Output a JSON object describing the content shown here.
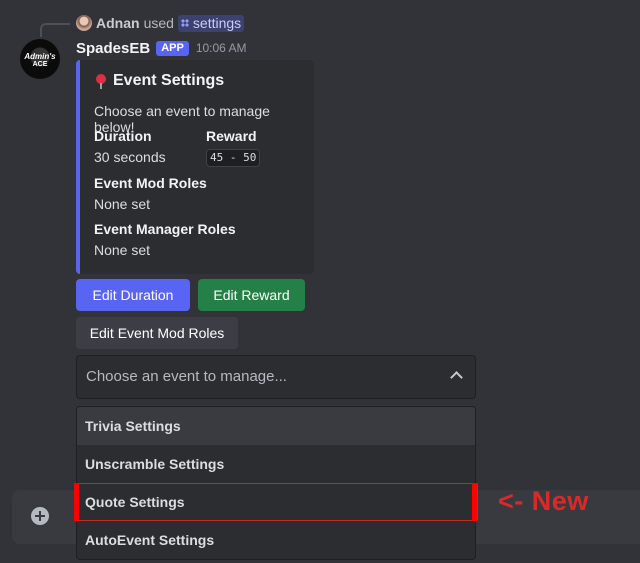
{
  "reply": {
    "user": "Adnan",
    "used_text": "used",
    "command": "settings"
  },
  "bot": {
    "avatar_text_top": "Admin's",
    "avatar_text_bottom": "ACE",
    "name": "SpadesEB",
    "tag": "APP",
    "timestamp": "10:06 AM"
  },
  "embed": {
    "accent_color": "#5865f2",
    "icon": "pin-icon",
    "title": "Event Settings",
    "description": "Choose an event to manage below!",
    "fields": {
      "duration": {
        "name": "Duration",
        "value": "30 seconds"
      },
      "reward": {
        "name": "Reward",
        "value": "45 - 50"
      },
      "mod_roles": {
        "name": "Event Mod Roles",
        "value": "None set"
      },
      "manager_roles": {
        "name": "Event Manager Roles",
        "value": "None set"
      }
    }
  },
  "buttons": {
    "edit_duration": "Edit Duration",
    "edit_reward": "Edit Reward",
    "edit_mod_roles": "Edit Event Mod Roles"
  },
  "select": {
    "placeholder": "Choose an event to manage...",
    "options": [
      "Trivia Settings",
      "Unscramble Settings",
      "Quote Settings",
      "AutoEvent Settings"
    ]
  },
  "annotation": {
    "label": "<- New",
    "color": "#d92a2a"
  }
}
